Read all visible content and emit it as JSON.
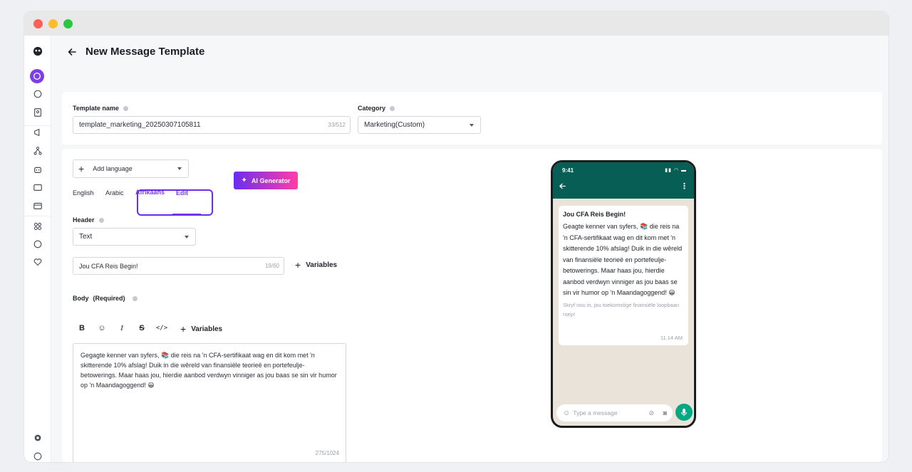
{
  "page": {
    "title": "New Message Template"
  },
  "template_name": {
    "label": "Template name",
    "value": "template_marketing_20250307105811",
    "counter": "33/512"
  },
  "category": {
    "label": "Category",
    "value": "Marketing(Custom)"
  },
  "language": {
    "add_label": "Add language",
    "ai_label": "AI Generator",
    "tabs": [
      "English",
      "Arabic",
      "Afrikaans"
    ],
    "active_tab": "Afrikaans",
    "edit_label": "Edit"
  },
  "header": {
    "label": "Header",
    "type_value": "Text",
    "text_value": "Jou CFA Reis Begin!",
    "counter": "19/60",
    "variables_label": "Variables"
  },
  "body": {
    "label": "Body",
    "required": "(Required)",
    "variables_label": "Variables",
    "text": "Gegagte kenner van syfers, 📚 die reis na 'n CFA-sertifikaat wag en dit kom met 'n skitterende 10% afslag! Duik in die wêreld van finansiële teorieë en portefeulje-betowerings. Maar haas jou, hierdie aanbod verdwyn vinniger as jou baas se sin vir humor op 'n Maandagoggend! 😀",
    "counter": "275/1024"
  },
  "preview": {
    "time": "9:41",
    "title": "Jou CFA Reis Begin!",
    "body": "Geagte kenner van syfers, 📚 die reis na 'n CFA-sertifikaat wag en dit kom met 'n skitterende 10% afslag! Duik in die wêreld van finansiële teorieë en portefeulje-betowerings. Maar haas jou, hierdie aanbod verdwyn vinniger as jou baas se sin vir humor op 'n Maandagoggend! 😀",
    "footer": "Skryf nou in, jou toekomstige finansiële loopbaan roep!",
    "timestamp": "11.14 AM",
    "composer_placeholder": "Type a message"
  },
  "colors": {
    "accent": "#7b3fe4",
    "whatsapp_header": "#075e54",
    "whatsapp_chat_bg": "#e9e3da",
    "mic": "#00a884"
  }
}
